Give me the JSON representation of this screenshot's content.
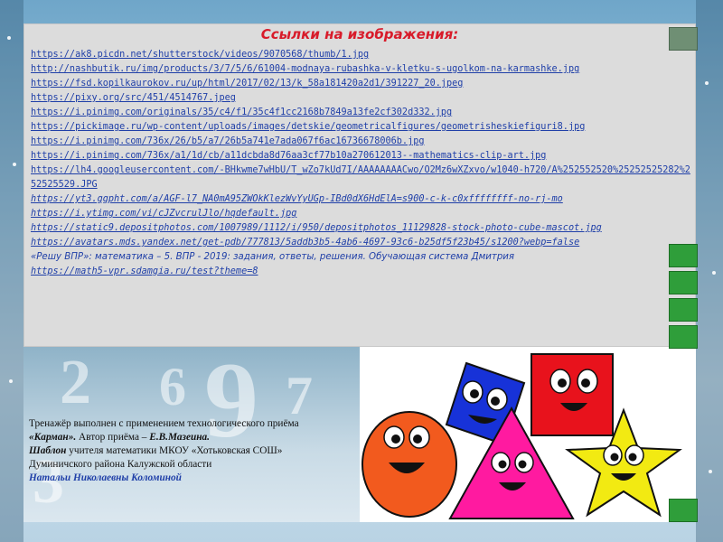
{
  "header": {
    "title": "Ссылки на изображения:"
  },
  "links": [
    "https://ak8.picdn.net/shutterstock/videos/9070568/thumb/1.jpg",
    "http://nashbutik.ru/img/products/3/7/5/6/61004-modnaya-rubashka-v-kletku-s-ugolkom-na-karmashke.jpg",
    "https://fsd.kopilkaurokov.ru/up/html/2017/02/13/k_58a181420a2d1/391227_20.jpeg",
    "https://pixy.org/src/451/4514767.jpeg",
    "https://i.pinimg.com/originals/35/c4/f1/35c4f1cc2168b7849a13fe2cf302d332.jpg",
    "https://pickimage.ru/wp-content/uploads/images/detskie/geometricalfigures/geometrisheskiefiguri8.jpg",
    "https://i.pinimg.com/736x/26/b5/a7/26b5a741e7ada067f6ac16736678006b.jpg",
    "https://i.pinimg.com/736x/a1/1d/cb/a11dcbda8d76aa3cf77b10a270612013--mathematics-clip-art.jpg",
    "https://lh4.googleusercontent.com/-BHkwme7wHbU/T_wZo7kUd7I/AAAAAAAACwo/O2Mz6wXZxvo/w1040-h720/A%252552520%25252525282%252525529.JPG",
    "https://yt3.ggpht.com/a/AGF-l7_NA0mA95ZWOkKlezWvYyUGp-IBd0dX6HdElA=s900-c-k-c0xffffffff-no-rj-mo",
    "https://i.ytimg.com/vi/cJZvcrulJlo/hqdefault.jpg",
    "https://static9.depositphotos.com/1007989/1112/i/950/depositphotos_11129828-stock-photo-cube-mascot.jpg",
    "https://avatars.mds.yandex.net/get-pdb/777813/5addb3b5-4ab6-4697-93c6-b25df5f23b45/s1200?webp=false"
  ],
  "source_text": "«Решу ВПР»: математика – 5. ВПР - 2019: задания, ответы, решения. Обучающая система Дмитрия",
  "source_link": "https://math5-vpr.sdamgia.ru/test?theme=8",
  "credits": {
    "line1": "Тренажёр выполнен с применением технологического приёма",
    "line2_bold": "«Карман».",
    "line2_rest": " Автор приёма – ",
    "line2_author": "Е.В.Мазеина.",
    "line3_bold": "Шаблон",
    "line3_rest": " учителя математики МКОУ «Хотьковская СОШ»",
    "line4": "Думиничского района Калужской области",
    "line5": "Натальи Николаевны Коломиной"
  },
  "background_numbers": [
    "9",
    "2",
    "6",
    "7",
    "3"
  ],
  "colors": {
    "title": "#d81b2a",
    "link": "#1f3fa8",
    "circle": "#f25a1e",
    "square": "#1732d8",
    "triangle": "#ff1aa0",
    "star": "#f2ea12",
    "red_square": "#e8121c",
    "nav_button": "#2f9e3a"
  }
}
